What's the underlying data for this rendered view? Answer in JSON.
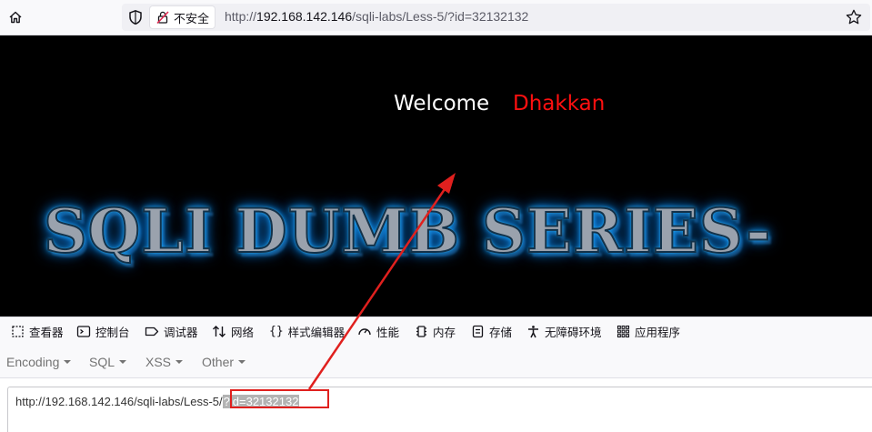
{
  "address_bar": {
    "security_label": "不安全",
    "url_prefix": "http://",
    "url_host": "192.168.142.146",
    "url_path": "/sqli-labs/Less-5/?id=32132132"
  },
  "page": {
    "welcome_label": "Welcome",
    "user_name": "Dhakkan",
    "banner_text": "SQLI DUMB SERIES-"
  },
  "devtools": {
    "tabs": [
      "查看器",
      "控制台",
      "调试器",
      "网络",
      "样式编辑器",
      "性能",
      "内存",
      "存储",
      "无障碍环境",
      "应用程序"
    ]
  },
  "hackbar": {
    "menus": [
      "Encoding",
      "SQL",
      "XSS",
      "Other"
    ],
    "load_url_prefix": "http://192.168.142.146/sqli-labs/Less-5/",
    "load_url_query": "?id=32132132"
  },
  "colors": {
    "welcome": "#ffffff",
    "user_name": "#ff1010",
    "annotation": "#e0201e"
  }
}
